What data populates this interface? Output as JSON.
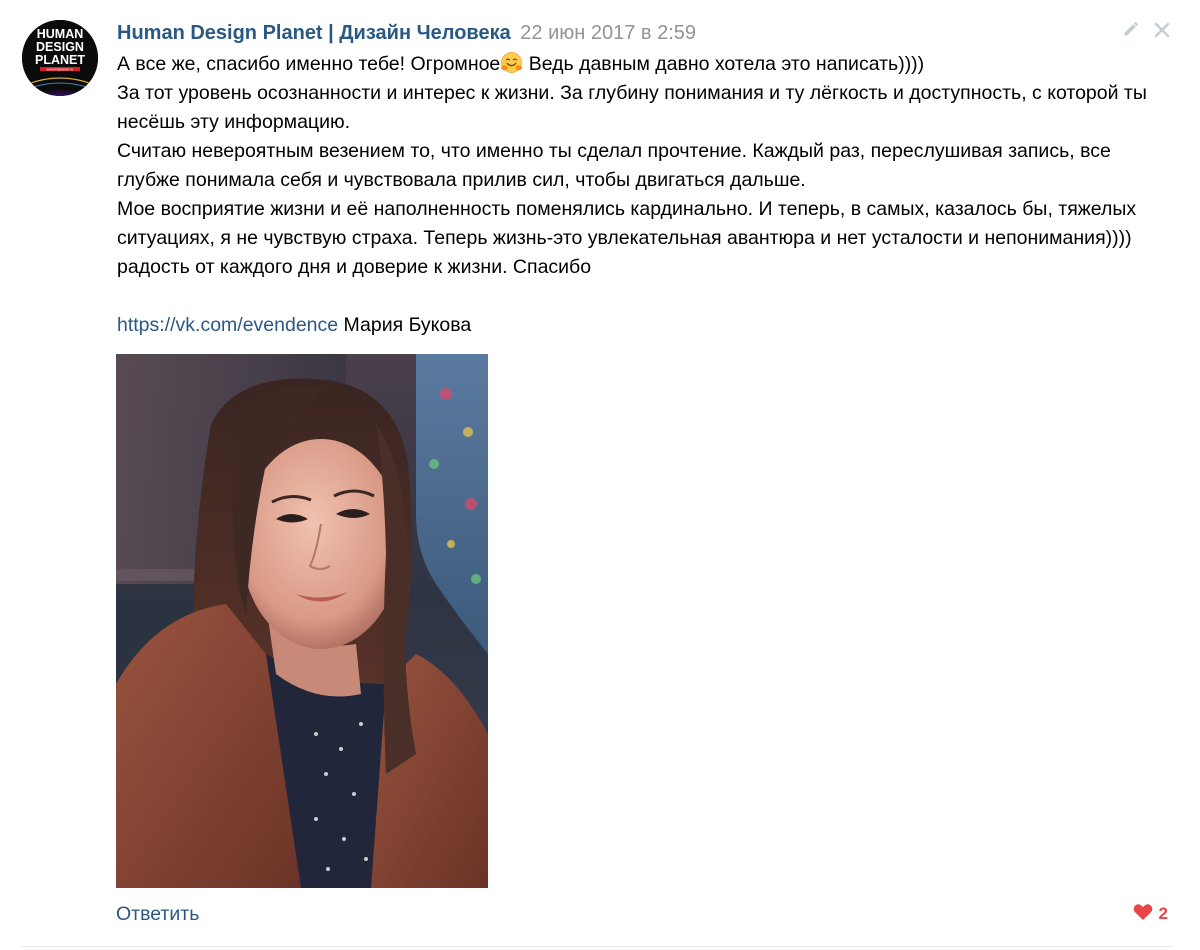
{
  "comment": {
    "author": "Human Design Planet | Дизайн Человека",
    "date": "22 июн 2017 в 2:59",
    "avatar": {
      "lines": [
        "HUMAN",
        "DESIGN",
        "PLANET"
      ],
      "site": "www.hdplanet.ru"
    },
    "text": {
      "line1_before_emoji": "А все же, спасибо именно тебе! Огромное",
      "emoji": "hugging-face-emoji",
      "line1_after_emoji": " Ведь давным давно хотела это написать))))",
      "paragraph2": "За тот уровень осознанности и интерес к жизни. За глубину понимания и ту лёгкость и доступность, с которой ты несёшь эту информацию.",
      "paragraph3": "Считаю невероятным везением то, что именно ты сделал прочтение. Каждый раз, переслушивая запись, все глубже понимала себя и чувствовала прилив сил, чтобы двигаться дальше.",
      "paragraph4": "Мое восприятие жизни и её наполненность поменялись кардинально. И теперь, в самых, казалось бы, тяжелых ситуациях, я не чувствую страха. Теперь жизнь-это увлекательная авантюра и нет усталости и непонимания)))) радость от каждого дня и доверие к жизни. Спасибо",
      "link": "https://vk.com/evendence",
      "signature": " Мария Букова"
    },
    "photo_icon": "portrait-photo",
    "reply_label": "Ответить",
    "likes": "2",
    "colors": {
      "link": "#2a5885",
      "meta": "#939393",
      "like": "#e64646",
      "divider": "#e7e8ec"
    },
    "icons": {
      "edit": "pencil-icon",
      "delete": "close-icon",
      "like": "heart-icon"
    }
  }
}
